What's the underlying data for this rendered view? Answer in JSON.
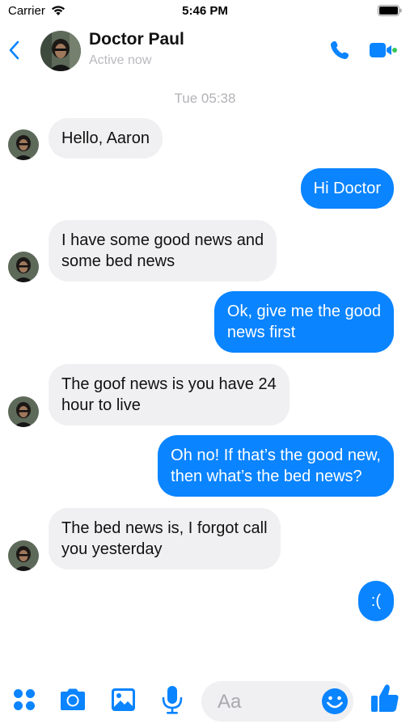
{
  "status_bar": {
    "carrier": "Carrier",
    "time": "5:46 PM"
  },
  "header": {
    "name": "Doctor Paul",
    "status": "Active now"
  },
  "conversation": {
    "timestamp": "Tue 05:38",
    "messages": [
      {
        "from": "them",
        "text_lines": [
          "Hello, Aaron"
        ]
      },
      {
        "from": "me",
        "text_lines": [
          "Hi Doctor"
        ]
      },
      {
        "from": "them",
        "text_lines": [
          "I have some good news and",
          "some bed news"
        ]
      },
      {
        "from": "me",
        "text_lines": [
          "Ok, give me the good",
          "news first"
        ]
      },
      {
        "from": "them",
        "text_lines": [
          "The goof news is you have 24",
          "hour to live"
        ]
      },
      {
        "from": "me",
        "text_lines": [
          "Oh no! If that’s the good new,",
          "then what’s the bed news?"
        ]
      },
      {
        "from": "them",
        "text_lines": [
          "The bed news is, I forgot call",
          "you yesterday"
        ]
      },
      {
        "from": "me",
        "text_lines": [
          ":("
        ]
      }
    ]
  },
  "composer": {
    "placeholder": "Aa",
    "icons": [
      "apps-icon",
      "camera-icon",
      "photo-icon",
      "microphone-icon",
      "emoji-icon",
      "thumbs-up-icon"
    ]
  },
  "colors": {
    "accent": "#0a84ff",
    "incoming_bubble": "#f0f0f2",
    "active_dot": "#34c759"
  }
}
